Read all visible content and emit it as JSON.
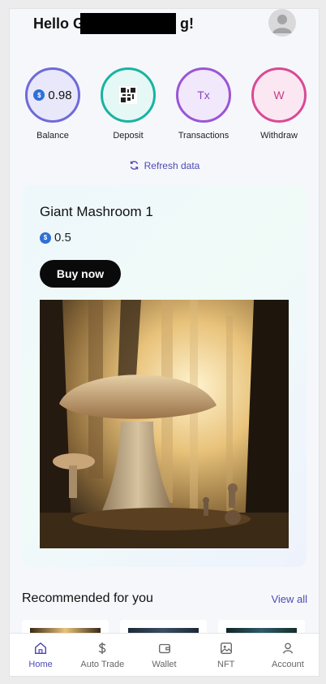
{
  "header": {
    "greeting_start": "Hello G",
    "greeting_end": "g!"
  },
  "quick_actions": [
    {
      "label": "Balance",
      "value": "0.98",
      "color": "#6f6ad8",
      "bg": "#e9e8fb"
    },
    {
      "label": "Deposit",
      "color": "#19b3a3",
      "bg": "#e6f8f5"
    },
    {
      "label": "Transactions",
      "text": "Tx",
      "color": "#9a55d6",
      "bg": "#f1e8fb"
    },
    {
      "label": "Withdraw",
      "text": "W",
      "color": "#d94a95",
      "bg": "#fbe7f2"
    }
  ],
  "refresh_label": "Refresh data",
  "featured": {
    "title": "Giant Mashroom 1",
    "price": "0.5",
    "buy_label": "Buy now"
  },
  "recommended": {
    "title": "Recommended for you",
    "view_all": "View all"
  },
  "tabs": [
    {
      "label": "Home",
      "icon": "home-icon",
      "active": true
    },
    {
      "label": "Auto Trade",
      "icon": "dollar-icon"
    },
    {
      "label": "Wallet",
      "icon": "wallet-icon"
    },
    {
      "label": "NFT",
      "icon": "image-icon"
    },
    {
      "label": "Account",
      "icon": "user-icon"
    }
  ],
  "accent_color": "#4e4ab3"
}
